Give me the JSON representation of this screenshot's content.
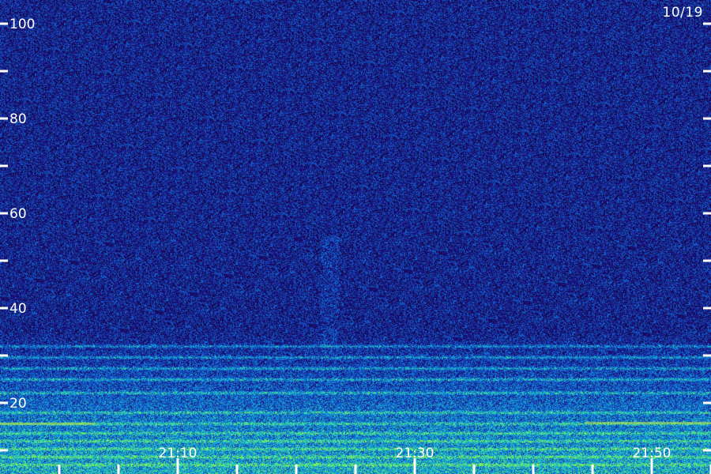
{
  "chart_data": {
    "type": "heatmap",
    "date_label": "10/19",
    "y_ticks": [
      {
        "value": 100,
        "label": "100"
      },
      {
        "value": 90,
        "label": ""
      },
      {
        "value": 80,
        "label": "80"
      },
      {
        "value": 70,
        "label": ""
      },
      {
        "value": 60,
        "label": "60"
      },
      {
        "value": 50,
        "label": ""
      },
      {
        "value": 40,
        "label": "40"
      },
      {
        "value": 30,
        "label": ""
      },
      {
        "value": 20,
        "label": "20"
      },
      {
        "value": 10,
        "label": ""
      }
    ],
    "ylim": [
      5,
      105
    ],
    "x_ticks": [
      {
        "value": 0,
        "label": ""
      },
      {
        "value": 5,
        "label": ""
      },
      {
        "value": 10,
        "label": "21:10"
      },
      {
        "value": 15,
        "label": ""
      },
      {
        "value": 20,
        "label": ""
      },
      {
        "value": 25,
        "label": ""
      },
      {
        "value": 30,
        "label": "21:30"
      },
      {
        "value": 35,
        "label": ""
      },
      {
        "value": 40,
        "label": ""
      },
      {
        "value": 45,
        "label": ""
      },
      {
        "value": 50,
        "label": "21:50"
      },
      {
        "value": 55,
        "label": ""
      }
    ],
    "xlim": [
      -5,
      55
    ],
    "colors": {
      "background": "#1c0c5c",
      "mid": "#1f3fd0",
      "high": "#20c8e0",
      "peak": "#90ff40",
      "axis": "#ffffff"
    }
  }
}
